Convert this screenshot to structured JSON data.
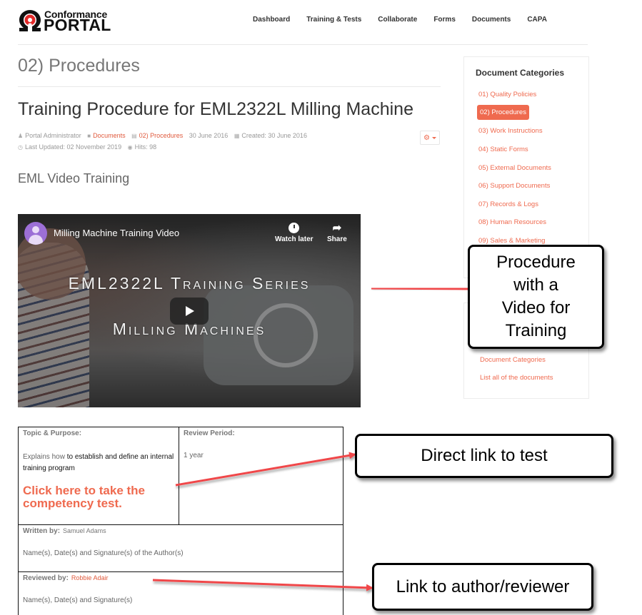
{
  "header": {
    "logo_top": "Conformance",
    "logo_bottom": "PORTAL",
    "nav": [
      "Dashboard",
      "Training & Tests",
      "Collaborate",
      "Forms",
      "Documents",
      "CAPA"
    ]
  },
  "page": {
    "category_title": "02) Procedures",
    "article_title": "Training Procedure for EML2322L Milling Machine",
    "meta": {
      "author": "Portal Administrator",
      "parent_category": "Documents",
      "category": "02) Procedures",
      "published": "30 June 2016",
      "created": "Created: 30 June 2016",
      "last_updated": "Last Updated: 02 November 2019",
      "hits": "Hits: 98"
    },
    "tools_icon": "gear-icon",
    "section_heading": "EML Video Training"
  },
  "video": {
    "title": "Milling Machine Training Video",
    "watch_later": "Watch later",
    "share": "Share",
    "overlay_line1": "EML2322L Training Series",
    "overlay_line2": "Milling Machines"
  },
  "doc_table": {
    "topic_label": "Topic & Purpose:",
    "topic_text_start": "Explains how",
    "topic_text_rest": " to establish and define an internal training program",
    "test_link": "Click here to take the competency test.",
    "review_label": "Review Period:",
    "review_value": "1 year",
    "written_label": "Written by:",
    "written_value": "Samuel Adams",
    "written_note": "Name(s), Date(s) and Signature(s) of the Author(s)",
    "reviewed_label": "Reviewed by:",
    "reviewed_value": "Robbie Adair",
    "reviewed_note": "Name(s), Date(s) and Signature(s)"
  },
  "sidebar": {
    "title": "Document Categories",
    "items": [
      {
        "label": "01) Quality Policies",
        "active": false
      },
      {
        "label": "02) Procedures",
        "active": true
      },
      {
        "label": "03) Work Instructions",
        "active": false
      },
      {
        "label": "04) Static Forms",
        "active": false
      },
      {
        "label": "05) External Documents",
        "active": false
      },
      {
        "label": "06) Support Documents",
        "active": false
      },
      {
        "label": "07) Records & Logs",
        "active": false
      },
      {
        "label": "08) Human Resources",
        "active": false
      },
      {
        "label": "09) Sales & Marketing",
        "active": false
      }
    ],
    "links": [
      "Document Categories",
      "List all of the documents"
    ]
  },
  "annotations": {
    "video_callout": [
      "Procedure",
      "with a",
      "Video for",
      "Training"
    ],
    "test_callout": "Direct link to test",
    "reviewer_callout": "Link to author/reviewer",
    "arrow_color": "#f0464a"
  },
  "colors": {
    "accent": "#ef6a4f",
    "link": "#e05a3d"
  }
}
